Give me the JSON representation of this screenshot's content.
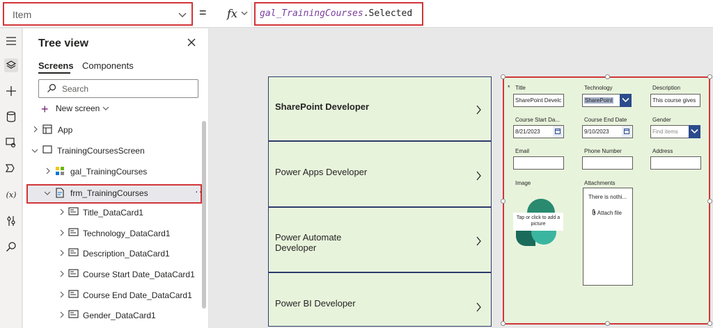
{
  "formula_bar": {
    "property": "Item",
    "equals": "=",
    "fx": "fx",
    "formula_var": "gal_TrainingCourses",
    "formula_rest": ".Selected"
  },
  "left_rail": {
    "icons": [
      "hamburger-icon",
      "layers-icon",
      "plus-icon",
      "database-icon",
      "media-icon",
      "components-icon",
      "variables-icon",
      "tools-icon",
      "search-icon"
    ],
    "variables_label": "(x)"
  },
  "tree_view": {
    "title": "Tree view",
    "tabs": [
      "Screens",
      "Components"
    ],
    "search_placeholder": "Search",
    "new_screen": "New screen",
    "nodes": [
      {
        "label": "App"
      },
      {
        "label": "TrainingCoursesScreen"
      },
      {
        "label": "gal_TrainingCourses"
      },
      {
        "label": "frm_TrainingCourses"
      },
      {
        "label": "Title_DataCard1"
      },
      {
        "label": "Technology_DataCard1"
      },
      {
        "label": "Description_DataCard1"
      },
      {
        "label": "Course Start Date_DataCard1"
      },
      {
        "label": "Course End Date_DataCard1"
      },
      {
        "label": "Gender_DataCard1"
      }
    ],
    "more": "···"
  },
  "gallery": {
    "items": [
      {
        "title": "SharePoint Developer"
      },
      {
        "title": "Power Apps Developer"
      },
      {
        "title": "Power Automate Developer",
        "line1": "Power Automate",
        "line2": "Developer"
      },
      {
        "title": "Power BI Developer"
      }
    ]
  },
  "form": {
    "required_marker": "*",
    "title_label": "Title",
    "title_value": "SharePoint Develc",
    "technology_label": "Technology",
    "technology_value": "SharePoint",
    "description_label": "Description",
    "description_value": "This course gives",
    "start_label": "Course Start Da...",
    "start_value": "8/21/2023",
    "end_label": "Course End Date",
    "end_value": "9/10/2023",
    "gender_label": "Gender",
    "gender_placeholder": "Find items",
    "email_label": "Email",
    "phone_label": "Phone Number",
    "address_label": "Address",
    "image_label": "Image",
    "image_tip_line1": "Tap or click to add a",
    "image_tip_line2": "picture",
    "attachments_label": "Attachments",
    "attachments_empty": "There is nothi...",
    "attach_file": "Attach file"
  },
  "colors": {
    "highlight": "#d13438",
    "form_bg": "#e8f3dc",
    "gallery_border": "#2b3a6b",
    "dropdown_blue": "#2b4b8c",
    "accent_purple": "#742774"
  }
}
